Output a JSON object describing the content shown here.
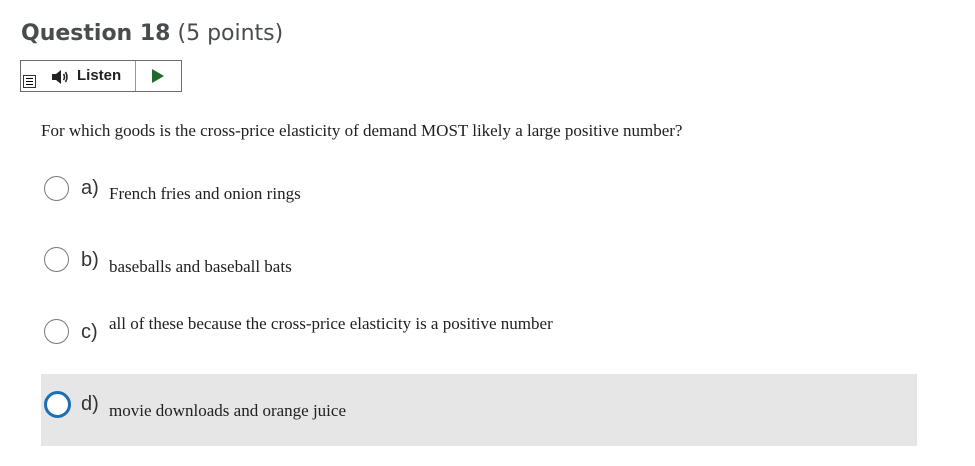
{
  "question": {
    "title": "Question 18",
    "points": "(5 points)",
    "text": "For which goods is the cross-price elasticity of demand MOST likely a large positive number?"
  },
  "listen": {
    "label": "Listen",
    "menu_icon": "menu-icon",
    "speaker_icon": "speaker-icon",
    "play_icon": "play-icon",
    "play_color": "#1f6b2a"
  },
  "options": [
    {
      "letter": "a)",
      "text": "French fries and onion rings",
      "selected": false
    },
    {
      "letter": "b)",
      "text": "baseballs and baseball bats",
      "selected": false
    },
    {
      "letter": "c)",
      "text": "all of these because the cross-price elasticity is a positive number",
      "selected": false
    },
    {
      "letter": "d)",
      "text": "movie downloads and orange juice",
      "selected": true
    }
  ],
  "colors": {
    "selected_background": "#e6e6e6",
    "selected_radio_border": "#1a6fb5"
  }
}
